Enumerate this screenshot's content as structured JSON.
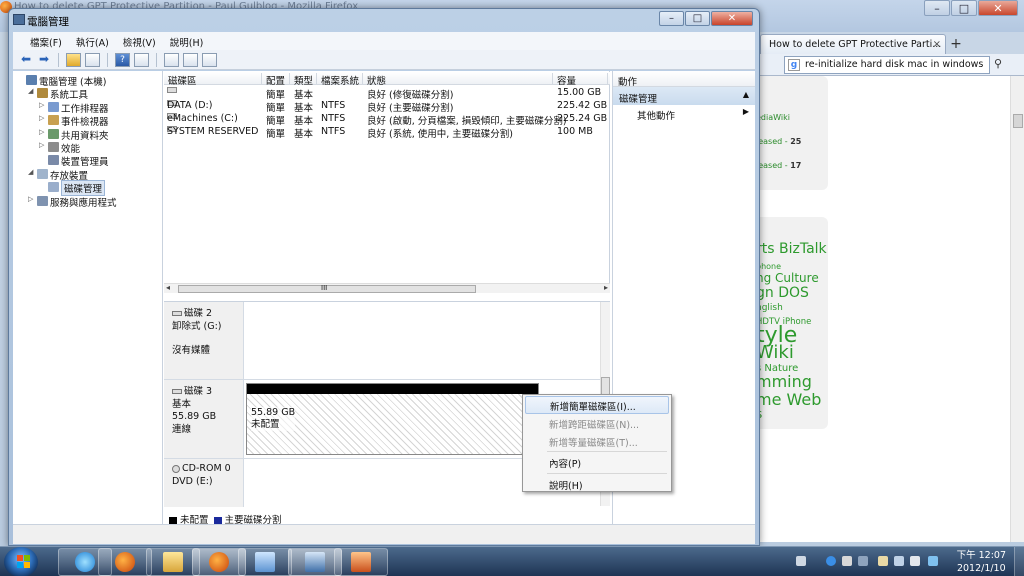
{
  "firefox": {
    "title": "How to delete GPT Protective Partition - Paul Gulblog - Mozilla Firefox",
    "tab_label": "How to delete GPT Protective Parti...",
    "tab_close": "×",
    "new_tab": "+",
    "search_value": "re-initialize hard disk mac in windows",
    "card1": [
      "ediaWiki",
      "leased - ",
      "25",
      "leased - ",
      "17"
    ],
    "tags": [
      "rts BizTalk",
      "phone",
      "ng Culture",
      "gn DOS",
      "nglish",
      "HDTV iPhone",
      "tyle",
      "Wiki",
      "s Nature",
      "mming",
      "me Web",
      "s"
    ],
    "winbtns": [
      "–",
      "□",
      "✕"
    ]
  },
  "cm": {
    "title": "電腦管理",
    "winbtns": [
      "–",
      "□",
      "✕"
    ],
    "menu": [
      "檔案(F)",
      "執行(A)",
      "檢視(V)",
      "說明(H)"
    ],
    "tree": [
      {
        "label": "電腦管理 (本機)",
        "exp": "",
        "indent": 0
      },
      {
        "label": "系統工具",
        "exp": "◢",
        "indent": 1
      },
      {
        "label": "工作排程器",
        "exp": "▷",
        "indent": 2
      },
      {
        "label": "事件檢視器",
        "exp": "▷",
        "indent": 2
      },
      {
        "label": "共用資料夾",
        "exp": "▷",
        "indent": 2
      },
      {
        "label": "效能",
        "exp": "▷",
        "indent": 2
      },
      {
        "label": "裝置管理員",
        "exp": "",
        "indent": 2
      },
      {
        "label": "存放裝置",
        "exp": "◢",
        "indent": 1
      },
      {
        "label": "磁碟管理",
        "exp": "",
        "indent": 2
      },
      {
        "label": "服務與應用程式",
        "exp": "▷",
        "indent": 1
      }
    ],
    "columns": [
      "磁碟區",
      "配置",
      "類型",
      "檔案系統",
      "狀態",
      "容量"
    ],
    "volumes": [
      {
        "name": "",
        "layout": "簡單",
        "type": "基本",
        "fs": "",
        "status": "良好 (修復磁碟分割)",
        "size": "15.00 GB"
      },
      {
        "name": "DATA (D:)",
        "layout": "簡單",
        "type": "基本",
        "fs": "NTFS",
        "status": "良好 (主要磁碟分割)",
        "size": "225.42 GB"
      },
      {
        "name": "eMachines (C:)",
        "layout": "簡單",
        "type": "基本",
        "fs": "NTFS",
        "status": "良好 (啟動, 分頁檔案, 損毀傾印, 主要磁碟分割)",
        "size": "225.24 GB"
      },
      {
        "name": "SYSTEM RESERVED",
        "layout": "簡單",
        "type": "基本",
        "fs": "NTFS",
        "status": "良好 (系統, 使用中, 主要磁碟分割)",
        "size": "100 MB"
      }
    ],
    "hscroll": {
      "left": "◂",
      "right": "▸",
      "grip": "III"
    },
    "disk2": {
      "name": "磁碟 2",
      "type": "卸除式 (G:)",
      "media": "沒有媒體"
    },
    "disk3": {
      "name": "磁碟 3",
      "type": "基本",
      "size": "55.89 GB",
      "state": "連線",
      "part_size": "55.89 GB",
      "part_label": "未配置"
    },
    "cdrom": {
      "name": "CD-ROM 0",
      "drive": "DVD (E:)"
    },
    "legend": [
      {
        "label": "未配置",
        "color": "#000000"
      },
      {
        "label": "主要磁碟分割",
        "color": "#1a2a9c"
      }
    ],
    "actions": {
      "header": "動作",
      "section": "磁碟管理",
      "item": "其他動作",
      "up": "▲",
      "more": "▶"
    },
    "context_menu": [
      {
        "label": "新增簡單磁碟區(I)...",
        "disabled": false,
        "highlight": true
      },
      {
        "label": "新增跨距磁碟區(N)...",
        "disabled": true
      },
      {
        "label": "新增等量磁碟區(T)...",
        "disabled": true
      },
      {
        "label": "內容(P)",
        "disabled": false
      },
      {
        "label": "說明(H)",
        "disabled": false
      }
    ],
    "toolbar": {
      "back": "⬅",
      "forward": "➡",
      "help": "?"
    }
  },
  "taskbar": {
    "time": "下午 12:07",
    "date": "2012/1/10"
  }
}
